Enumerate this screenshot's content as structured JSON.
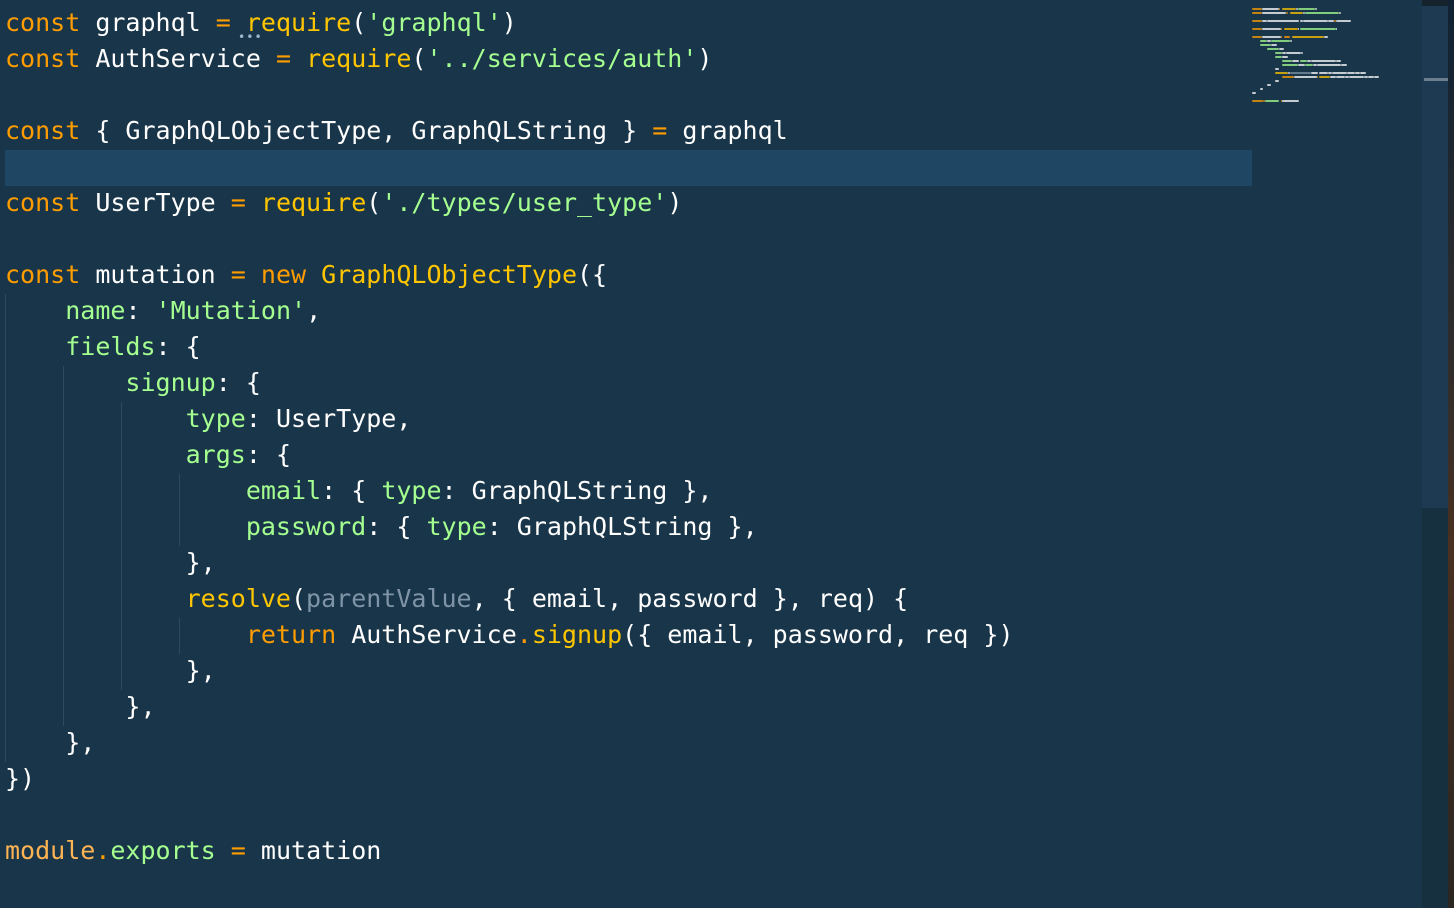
{
  "editor": {
    "theme_colors": {
      "background": "#193549",
      "current_line": "#1f4662",
      "keyword": "#ff9d00",
      "function": "#ffc600",
      "string": "#a5ff90",
      "property": "#9effff",
      "plain": "#ffffff",
      "parameter": "#7f94a6"
    },
    "lines": [
      [
        {
          "t": "kw",
          "v": "const"
        },
        {
          "t": "id",
          "v": " graphql "
        },
        {
          "t": "op",
          "v": "="
        },
        {
          "t": "id",
          "v": " "
        },
        {
          "t": "fn",
          "v": "require"
        },
        {
          "t": "pun",
          "v": "("
        },
        {
          "t": "str",
          "v": "'graphql'"
        },
        {
          "t": "pun",
          "v": ")"
        }
      ],
      [
        {
          "t": "kw",
          "v": "const"
        },
        {
          "t": "id",
          "v": " AuthService "
        },
        {
          "t": "op",
          "v": "="
        },
        {
          "t": "id",
          "v": " "
        },
        {
          "t": "fn",
          "v": "require"
        },
        {
          "t": "pun",
          "v": "("
        },
        {
          "t": "str",
          "v": "'../services/auth'"
        },
        {
          "t": "pun",
          "v": ")"
        }
      ],
      [],
      [
        {
          "t": "kw",
          "v": "const"
        },
        {
          "t": "pun",
          "v": " { "
        },
        {
          "t": "id",
          "v": "GraphQLObjectType"
        },
        {
          "t": "pun",
          "v": ", "
        },
        {
          "t": "id",
          "v": "GraphQLString"
        },
        {
          "t": "pun",
          "v": " } "
        },
        {
          "t": "op",
          "v": "="
        },
        {
          "t": "id",
          "v": " graphql"
        }
      ],
      [],
      [
        {
          "t": "kw",
          "v": "const"
        },
        {
          "t": "id",
          "v": " UserType "
        },
        {
          "t": "op",
          "v": "="
        },
        {
          "t": "id",
          "v": " "
        },
        {
          "t": "fn",
          "v": "require"
        },
        {
          "t": "pun",
          "v": "("
        },
        {
          "t": "str",
          "v": "'./types/user_type'"
        },
        {
          "t": "pun",
          "v": ")"
        }
      ],
      [],
      [
        {
          "t": "kw",
          "v": "const"
        },
        {
          "t": "id",
          "v": " mutation "
        },
        {
          "t": "op",
          "v": "="
        },
        {
          "t": "id",
          "v": " "
        },
        {
          "t": "kw",
          "v": "new"
        },
        {
          "t": "id",
          "v": " "
        },
        {
          "t": "cls",
          "v": "GraphQLObjectType"
        },
        {
          "t": "pun",
          "v": "({"
        }
      ],
      [
        {
          "t": "id",
          "v": "    "
        },
        {
          "t": "key",
          "v": "name"
        },
        {
          "t": "pun",
          "v": ": "
        },
        {
          "t": "str",
          "v": "'Mutation'"
        },
        {
          "t": "pun",
          "v": ","
        }
      ],
      [
        {
          "t": "id",
          "v": "    "
        },
        {
          "t": "key",
          "v": "fields"
        },
        {
          "t": "pun",
          "v": ": {"
        }
      ],
      [
        {
          "t": "id",
          "v": "        "
        },
        {
          "t": "key",
          "v": "signup"
        },
        {
          "t": "pun",
          "v": ": {"
        }
      ],
      [
        {
          "t": "id",
          "v": "            "
        },
        {
          "t": "key",
          "v": "type"
        },
        {
          "t": "pun",
          "v": ": "
        },
        {
          "t": "id",
          "v": "UserType"
        },
        {
          "t": "pun",
          "v": ","
        }
      ],
      [
        {
          "t": "id",
          "v": "            "
        },
        {
          "t": "key",
          "v": "args"
        },
        {
          "t": "pun",
          "v": ": {"
        }
      ],
      [
        {
          "t": "id",
          "v": "                "
        },
        {
          "t": "key",
          "v": "email"
        },
        {
          "t": "pun",
          "v": ": { "
        },
        {
          "t": "key",
          "v": "type"
        },
        {
          "t": "pun",
          "v": ": "
        },
        {
          "t": "id",
          "v": "GraphQLString"
        },
        {
          "t": "pun",
          "v": " },"
        }
      ],
      [
        {
          "t": "id",
          "v": "                "
        },
        {
          "t": "key",
          "v": "password"
        },
        {
          "t": "pun",
          "v": ": { "
        },
        {
          "t": "key",
          "v": "type"
        },
        {
          "t": "pun",
          "v": ": "
        },
        {
          "t": "id",
          "v": "GraphQLString"
        },
        {
          "t": "pun",
          "v": " },"
        }
      ],
      [
        {
          "t": "id",
          "v": "            "
        },
        {
          "t": "pun",
          "v": "},"
        }
      ],
      [
        {
          "t": "id",
          "v": "            "
        },
        {
          "t": "fn",
          "v": "resolve"
        },
        {
          "t": "pun",
          "v": "("
        },
        {
          "t": "param",
          "v": "parentValue"
        },
        {
          "t": "pun",
          "v": ", { "
        },
        {
          "t": "id",
          "v": "email"
        },
        {
          "t": "pun",
          "v": ", "
        },
        {
          "t": "id",
          "v": "password"
        },
        {
          "t": "pun",
          "v": " }, "
        },
        {
          "t": "id",
          "v": "req"
        },
        {
          "t": "pun",
          "v": ") {"
        }
      ],
      [
        {
          "t": "id",
          "v": "                "
        },
        {
          "t": "kw",
          "v": "return"
        },
        {
          "t": "id",
          "v": " AuthService"
        },
        {
          "t": "op",
          "v": "."
        },
        {
          "t": "fn",
          "v": "signup"
        },
        {
          "t": "pun",
          "v": "({ "
        },
        {
          "t": "id",
          "v": "email"
        },
        {
          "t": "pun",
          "v": ", "
        },
        {
          "t": "id",
          "v": "password"
        },
        {
          "t": "pun",
          "v": ", "
        },
        {
          "t": "id",
          "v": "req"
        },
        {
          "t": "pun",
          "v": " })"
        }
      ],
      [
        {
          "t": "id",
          "v": "            "
        },
        {
          "t": "pun",
          "v": "},"
        }
      ],
      [
        {
          "t": "id",
          "v": "        "
        },
        {
          "t": "pun",
          "v": "},"
        }
      ],
      [
        {
          "t": "id",
          "v": "    "
        },
        {
          "t": "pun",
          "v": "},"
        }
      ],
      [
        {
          "t": "pun",
          "v": "})"
        }
      ],
      [],
      [
        {
          "t": "mod",
          "v": "module"
        },
        {
          "t": "op",
          "v": "."
        },
        {
          "t": "key",
          "v": "exports"
        },
        {
          "t": "id",
          "v": " "
        },
        {
          "t": "op",
          "v": "="
        },
        {
          "t": "id",
          "v": " mutation"
        }
      ]
    ]
  }
}
